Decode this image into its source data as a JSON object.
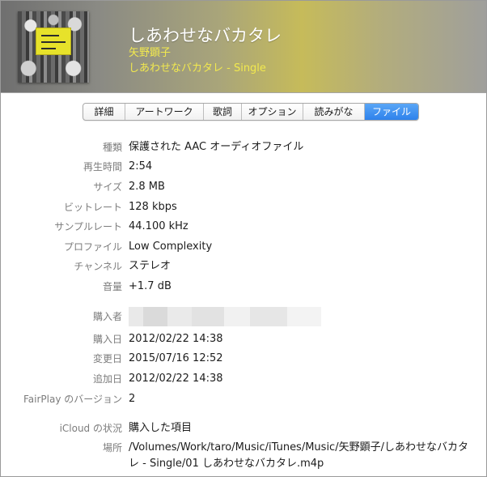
{
  "header": {
    "title": "しあわせなバカタレ",
    "artist": "矢野顕子",
    "album": "しあわせなバカタレ - Single",
    "colors": {
      "accent_text": "#f2e94e",
      "title_text": "#ffffff"
    }
  },
  "tabs": [
    {
      "label": "詳細",
      "active": false
    },
    {
      "label": "アートワーク",
      "active": false
    },
    {
      "label": "歌詞",
      "active": false
    },
    {
      "label": "オプション",
      "active": false
    },
    {
      "label": "読みがな",
      "active": false
    },
    {
      "label": "ファイル",
      "active": true
    }
  ],
  "file_info": {
    "kind": {
      "label": "種類",
      "value": "保護された AAC オーディオファイル"
    },
    "duration": {
      "label": "再生時間",
      "value": "2:54"
    },
    "size": {
      "label": "サイズ",
      "value": "2.8 MB"
    },
    "bitrate": {
      "label": "ビットレート",
      "value": "128 kbps"
    },
    "sample_rate": {
      "label": "サンプルレート",
      "value": "44.100 kHz"
    },
    "profile": {
      "label": "プロファイル",
      "value": "Low Complexity"
    },
    "channels": {
      "label": "チャンネル",
      "value": "ステレオ"
    },
    "volume": {
      "label": "音量",
      "value": "+1.7 dB"
    },
    "purchaser": {
      "label": "購入者"
    },
    "purchase_date": {
      "label": "購入日",
      "value": "2012/02/22 14:38"
    },
    "modified_date": {
      "label": "変更日",
      "value": "2015/07/16 12:52"
    },
    "added_date": {
      "label": "追加日",
      "value": "2012/02/22 14:38"
    },
    "fairplay_version": {
      "label": "FairPlay のバージョン",
      "value": "2"
    },
    "icloud_status": {
      "label": "iCloud の状況",
      "value": "購入した項目"
    },
    "location": {
      "label": "場所",
      "value": "/Volumes/Work/taro/Music/iTunes/Music/矢野顕子/しあわせなバカタレ - Single/01 しあわせなバカタレ.m4p"
    }
  }
}
